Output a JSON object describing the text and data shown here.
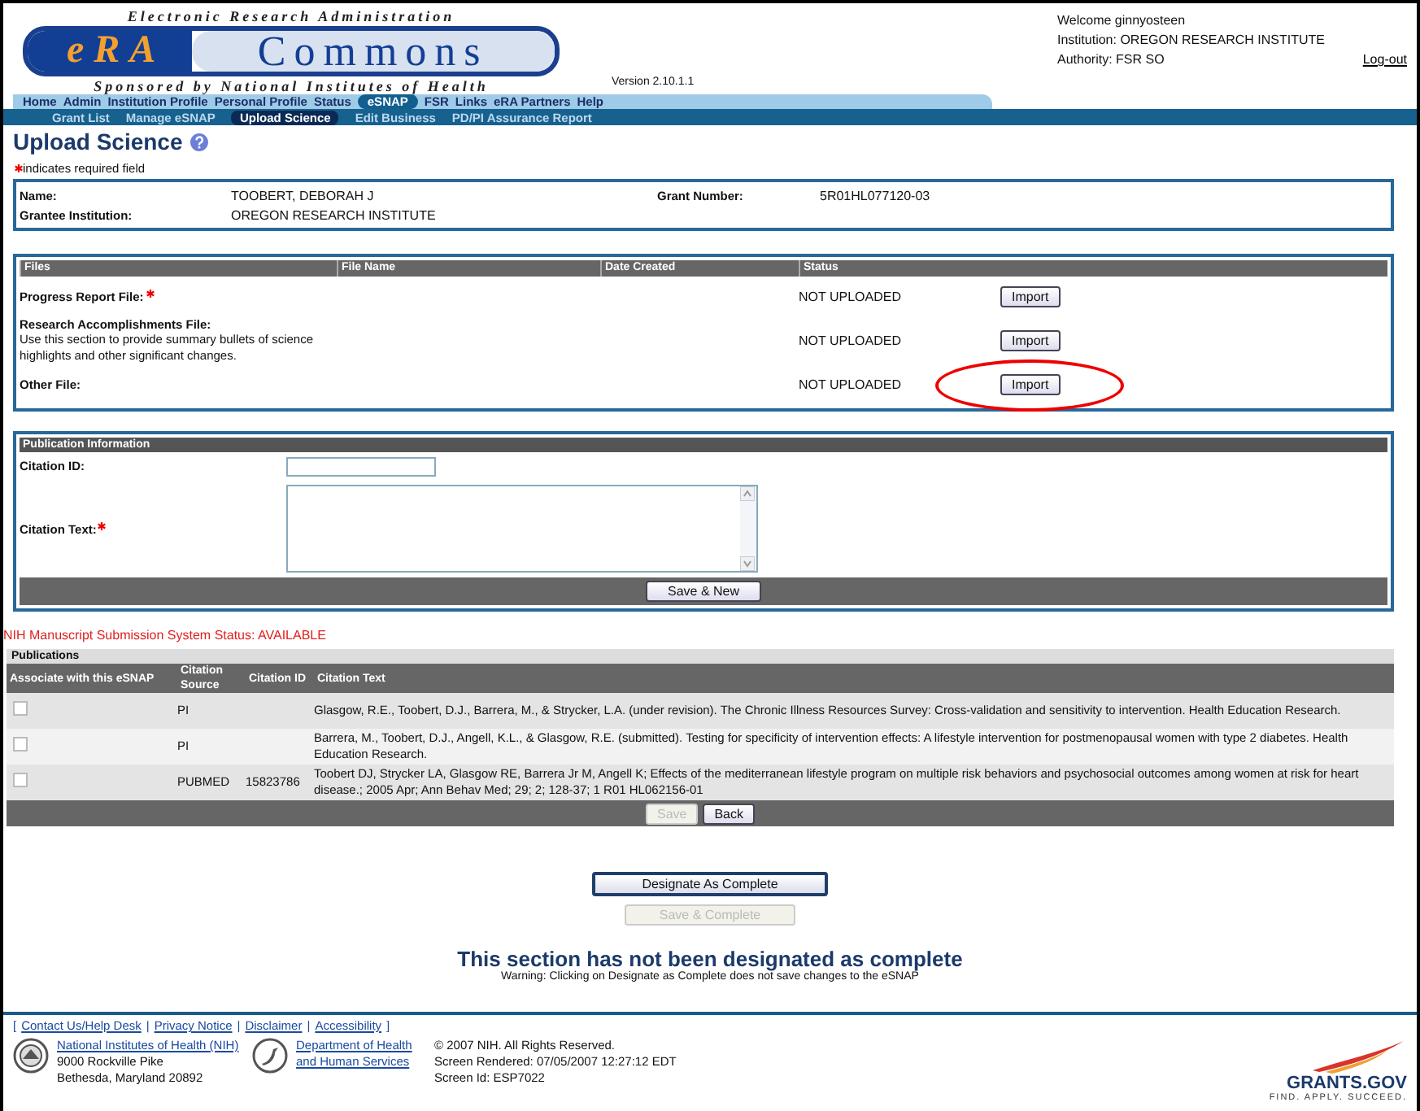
{
  "header": {
    "logo_top": "Electronic Research Administration",
    "logo_era": "eRA",
    "logo_commons": "Commons",
    "logo_bottom": "Sponsored by National Institutes of Health",
    "version": "Version 2.10.1.1",
    "welcome": "Welcome  ginnyosteen",
    "institution": "Institution: OREGON RESEARCH INSTITUTE",
    "authority": "Authority:   FSR  SO",
    "logout": "Log-out"
  },
  "nav": [
    {
      "label": "Home",
      "selected": false
    },
    {
      "label": "Admin",
      "selected": false
    },
    {
      "label": "Institution Profile",
      "selected": false
    },
    {
      "label": "Personal Profile",
      "selected": false
    },
    {
      "label": "Status",
      "selected": false
    },
    {
      "label": "eSNAP",
      "selected": true
    },
    {
      "label": "FSR",
      "selected": false
    },
    {
      "label": "Links",
      "selected": false
    },
    {
      "label": "eRA Partners",
      "selected": false
    },
    {
      "label": "Help",
      "selected": false
    }
  ],
  "subnav": [
    {
      "label": "Grant List",
      "selected": false
    },
    {
      "label": "Manage eSNAP",
      "selected": false
    },
    {
      "label": "Upload Science",
      "selected": true
    },
    {
      "label": "Edit Business",
      "selected": false
    },
    {
      "label": "PD/PI Assurance Report",
      "selected": false
    }
  ],
  "page_title": "Upload Science",
  "required_note": "indicates required field",
  "info": [
    {
      "label": "Name:",
      "value": "TOOBERT, DEBORAH J",
      "label2": "Grant Number:",
      "value2": "5R01HL077120-03"
    },
    {
      "label": "Grantee Institution:",
      "value": "OREGON RESEARCH INSTITUTE"
    }
  ],
  "files": {
    "columns": [
      "Files",
      "File Name",
      "Date Created",
      "Status"
    ],
    "rows": [
      {
        "label": "Progress Report File:",
        "required": true,
        "status": "NOT UPLOADED",
        "button": "Import",
        "highlighted": false
      },
      {
        "label": "Research Accomplishments File:",
        "required": false,
        "description": "Use this section to provide summary bullets of science highlights and other significant changes.",
        "status": "NOT UPLOADED",
        "button": "Import",
        "highlighted": false
      },
      {
        "label": "Other File:",
        "required": false,
        "status": "NOT UPLOADED",
        "button": "Import",
        "highlighted": true
      }
    ]
  },
  "publication_form": {
    "title": "Publication Information",
    "citation_id_label": "Citation ID:",
    "citation_text_label": "Citation Text:",
    "button": "Save & New"
  },
  "nihms_status": "NIH Manuscript Submission System Status: AVAILABLE",
  "publications": {
    "title": "Publications",
    "columns": [
      "Associate with this eSNAP",
      "Citation Source",
      "Citation ID",
      "Citation Text"
    ],
    "rows": [
      {
        "checked": false,
        "source": "PI",
        "id": "",
        "text": "Glasgow, R.E., Toobert, D.J., Barrera, M., & Strycker, L.A. (under revision). The Chronic Illness Resources Survey: Cross-validation and sensitivity to intervention. Health Education Research."
      },
      {
        "checked": false,
        "source": "PI",
        "id": "",
        "text": "Barrera, M., Toobert, D.J., Angell, K.L., & Glasgow, R.E. (submitted). Testing for specificity of intervention effects: A lifestyle intervention for postmenopausal women with type 2 diabetes. Health Education Research."
      },
      {
        "checked": false,
        "source": "PUBMED",
        "id": "15823786",
        "text": "Toobert DJ, Strycker LA, Glasgow RE, Barrera Jr M, Angell K; Effects of the mediterranean lifestyle program on multiple risk behaviors and psychosocial outcomes among women at risk for heart disease.; 2005 Apr; Ann Behav Med; 29; 2; 128-37; 1 R01 HL062156-01"
      }
    ],
    "buttons": [
      {
        "label": "Save",
        "disabled": true
      },
      {
        "label": "Back",
        "disabled": false
      }
    ]
  },
  "complete_buttons": [
    {
      "label": "Designate As Complete",
      "disabled": false
    },
    {
      "label": "Save & Complete",
      "disabled": true
    }
  ],
  "status_heading": "This section has not been designated as complete",
  "warning": "Warning: Clicking on Designate as Complete does not save changes to the eSNAP",
  "footer": {
    "links": [
      {
        "kind": "bracket",
        "text": "["
      },
      {
        "kind": "link",
        "text": "Contact Us/Help Desk"
      },
      {
        "kind": "separator",
        "text": "|"
      },
      {
        "kind": "link",
        "text": "Privacy Notice"
      },
      {
        "kind": "separator",
        "text": "|"
      },
      {
        "kind": "link",
        "text": "Disclaimer"
      },
      {
        "kind": "separator",
        "text": "|"
      },
      {
        "kind": "link",
        "text": "Accessibility"
      },
      {
        "kind": "bracket",
        "text": "]"
      }
    ],
    "nih": {
      "link": "National Institutes of Health (NIH)",
      "lines": [
        "9000 Rockville Pike",
        "Bethesda, Maryland 20892"
      ]
    },
    "hhs": {
      "link": "Department of Health and Human Services"
    },
    "info": [
      "© 2007 NIH. All Rights Reserved.",
      "Screen Rendered: 07/05/2007 12:27:12 EDT",
      "Screen Id: ESP7022"
    ],
    "grants_name": "GRANTS.GOV",
    "grants_tagline": "FIND. APPLY. SUCCEED."
  }
}
